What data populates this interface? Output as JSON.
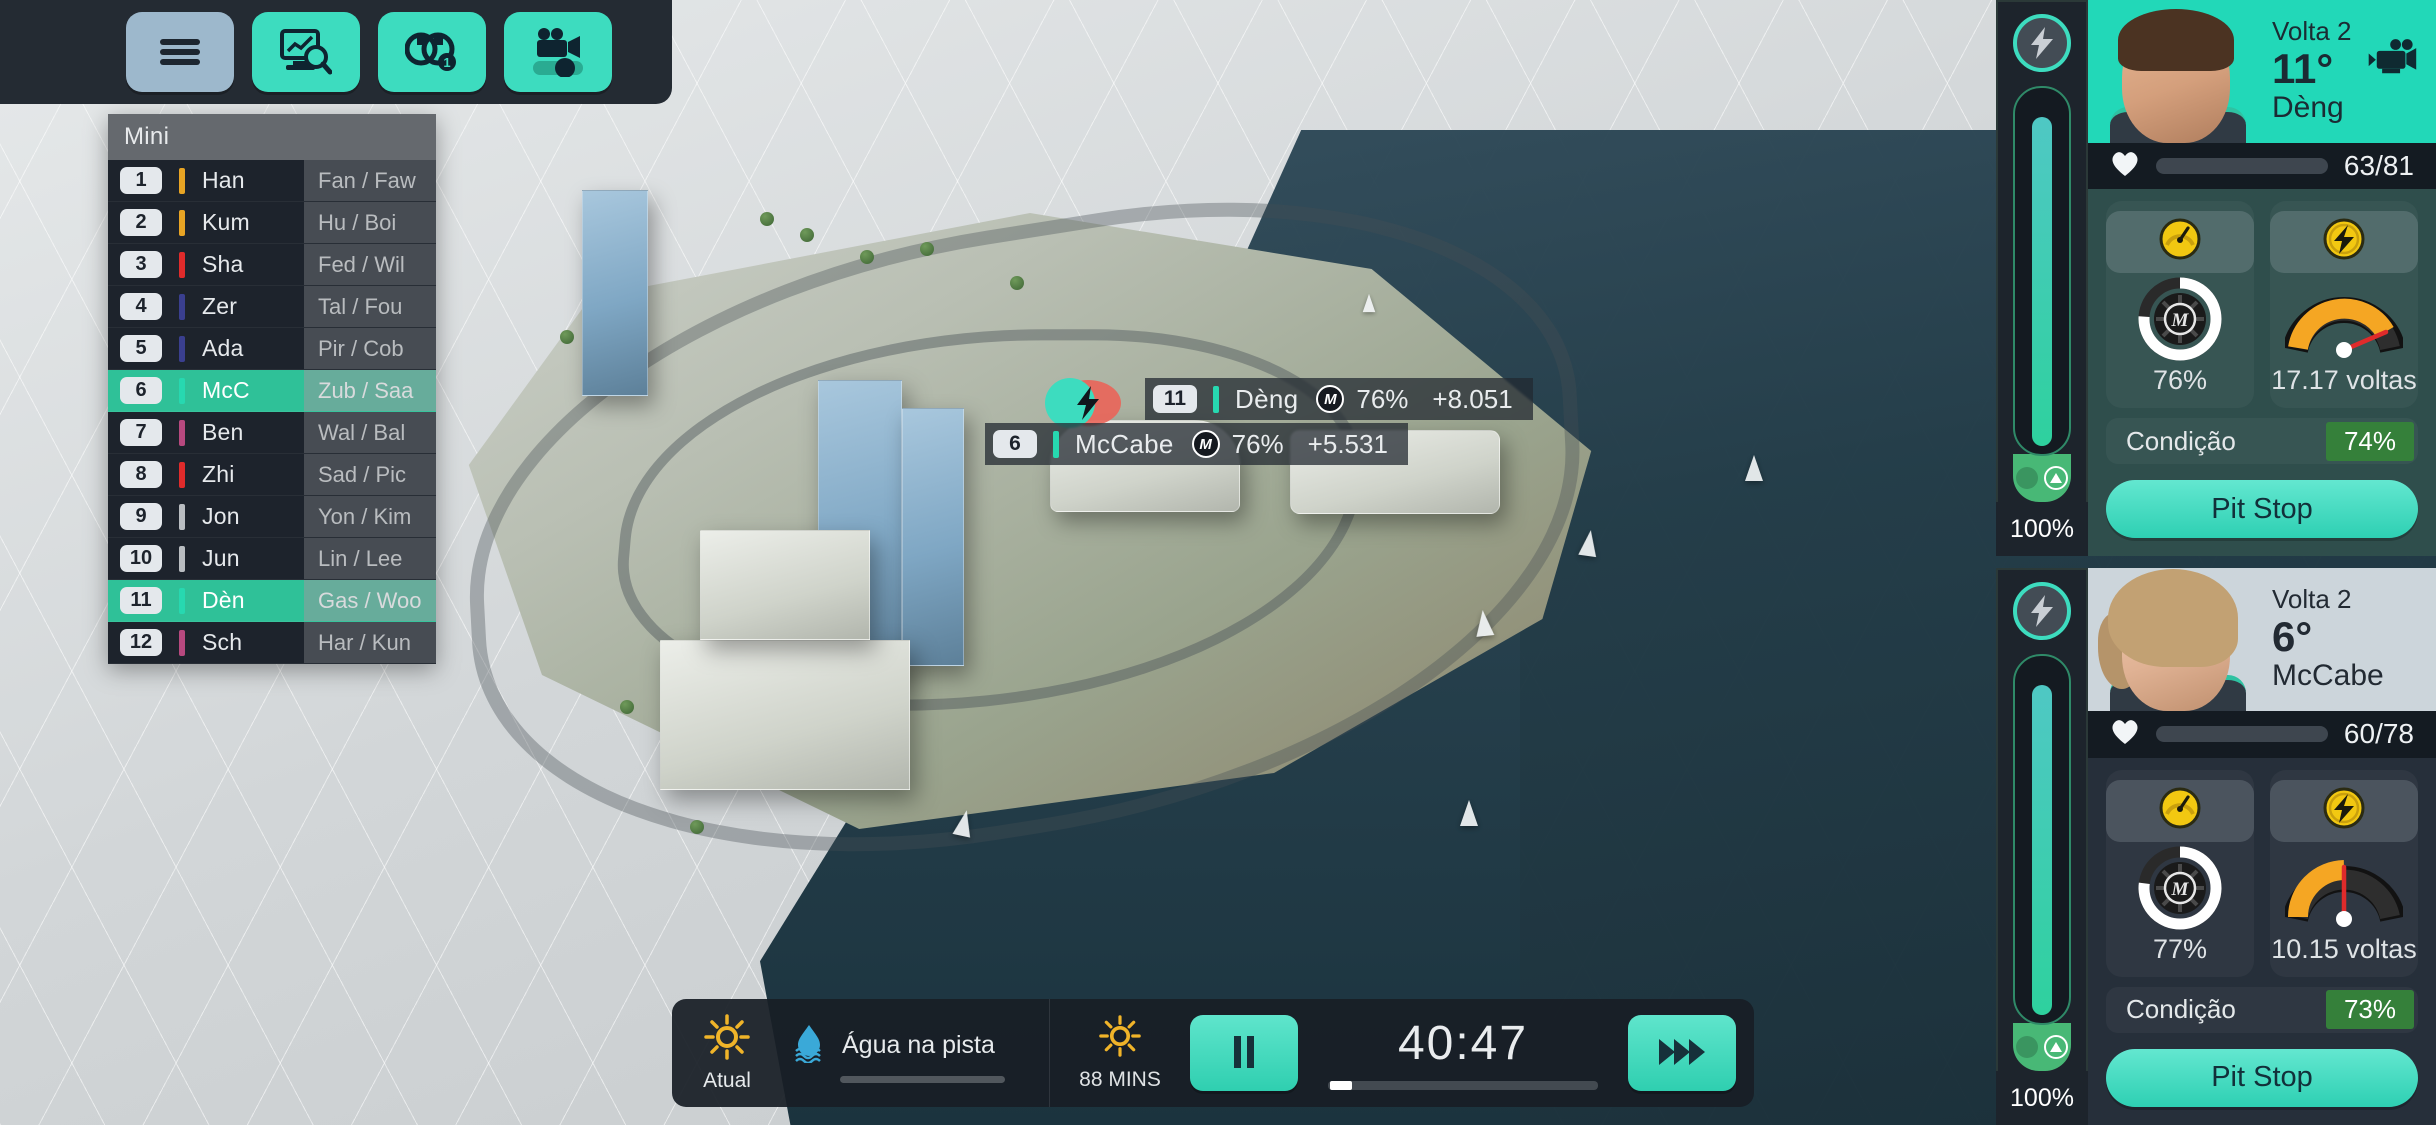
{
  "toolbar": {
    "buttons": [
      {
        "name": "menu-button",
        "icon": "hamburger-icon",
        "active": true
      },
      {
        "name": "analysis-button",
        "icon": "chart-search-icon",
        "active": false
      },
      {
        "name": "tyres-button",
        "icon": "tyres-icon",
        "badge": "1",
        "active": false
      },
      {
        "name": "camera-button",
        "icon": "camera-slider-icon",
        "active": false
      }
    ]
  },
  "standings": {
    "title": "Mini",
    "rows": [
      {
        "pos": "1",
        "abbr": "Han",
        "teams": "Fan / Faw",
        "color": "#e8a424",
        "highlight": false
      },
      {
        "pos": "2",
        "abbr": "Kum",
        "teams": "Hu / Boi",
        "color": "#e8a424",
        "highlight": false
      },
      {
        "pos": "3",
        "abbr": "Sha",
        "teams": "Fed / Wil",
        "color": "#e02b2b",
        "highlight": false
      },
      {
        "pos": "4",
        "abbr": "Zer",
        "teams": "Tal / Fou",
        "color": "#3a3f8f",
        "highlight": false
      },
      {
        "pos": "5",
        "abbr": "Ada",
        "teams": "Pir / Cob",
        "color": "#3a3f8f",
        "highlight": false
      },
      {
        "pos": "6",
        "abbr": "McC",
        "teams": "Zub / Saa",
        "color": "#27d8b0",
        "highlight": true
      },
      {
        "pos": "7",
        "abbr": "Ben",
        "teams": "Wal / Bal",
        "color": "#b7497f",
        "highlight": false
      },
      {
        "pos": "8",
        "abbr": "Zhi",
        "teams": "Sad / Pic",
        "color": "#e02b2b",
        "highlight": false
      },
      {
        "pos": "9",
        "abbr": "Jon",
        "teams": "Yon / Kim",
        "color": "#b9bdc1",
        "highlight": false
      },
      {
        "pos": "10",
        "abbr": "Jun",
        "teams": "Lin / Lee",
        "color": "#b9bdc1",
        "highlight": false
      },
      {
        "pos": "11",
        "abbr": "Dèn",
        "teams": "Gas / Woo",
        "color": "#27d8b0",
        "highlight": true
      },
      {
        "pos": "12",
        "abbr": "Sch",
        "teams": "Har / Kun",
        "color": "#b7497f",
        "highlight": false
      }
    ]
  },
  "track_labels": [
    {
      "pos": "11",
      "name": "Dèng",
      "tyre": "M",
      "pct": "76%",
      "gap": "+8.051",
      "color": "#27d8b0"
    },
    {
      "pos": "6",
      "name": "McCabe",
      "tyre": "M",
      "pct": "76%",
      "gap": "+5.531",
      "color": "#27d8b0"
    }
  ],
  "bottom_bar": {
    "current_label": "Atual",
    "current_icon": "sun-icon",
    "water_icon": "water-drop-icon",
    "water_label": "Água na pista",
    "forecast_icon": "sun-icon",
    "forecast_label": "88 MINS",
    "pause_icon": "pause-icon",
    "clock": "40:47",
    "fast_forward_icon": "fast-forward-icon"
  },
  "driver_cards": [
    {
      "energy": {
        "icon": "lightning-icon",
        "percent": "100%",
        "fill_pct": 100,
        "up_icon": "up-arrow-icon"
      },
      "lap_label": "Volta 2",
      "position": "11°",
      "name": "Dèng",
      "camera_icon": "camera-icon",
      "health_icon": "heart-icon",
      "health_value": "63/81",
      "health_pct": 78,
      "gauges": [
        {
          "pill_icon": "speed-dial-icon",
          "type": "tyre",
          "label": "76%",
          "value": 76
        },
        {
          "pill_icon": "energy-bolt-icon",
          "type": "fuel",
          "label": "17.17 voltas",
          "value": 78
        }
      ],
      "condition_label": "Condição",
      "condition_value": "74%",
      "pit_stop_label": "Pit Stop",
      "theme": "teal"
    },
    {
      "energy": {
        "icon": "lightning-icon",
        "percent": "100%",
        "fill_pct": 100,
        "up_icon": "up-arrow-icon"
      },
      "lap_label": "Volta 2",
      "position": "6°",
      "name": "McCabe",
      "camera_icon": "camera-icon",
      "health_icon": "heart-icon",
      "health_value": "60/78",
      "health_pct": 60,
      "gauges": [
        {
          "pill_icon": "speed-dial-icon",
          "type": "tyre",
          "label": "77%",
          "value": 77
        },
        {
          "pill_icon": "energy-bolt-icon",
          "type": "fuel",
          "label": "10.15 voltas",
          "value": 47
        }
      ],
      "condition_label": "Condição",
      "condition_value": "73%",
      "pit_stop_label": "Pit Stop",
      "theme": "light"
    }
  ],
  "colors": {
    "accent": "#3ddcbf",
    "panel_dark": "#1d232c",
    "highlight_green": "#2fc198",
    "health_green": "#5ebd63",
    "condition_green": "#35803a"
  }
}
